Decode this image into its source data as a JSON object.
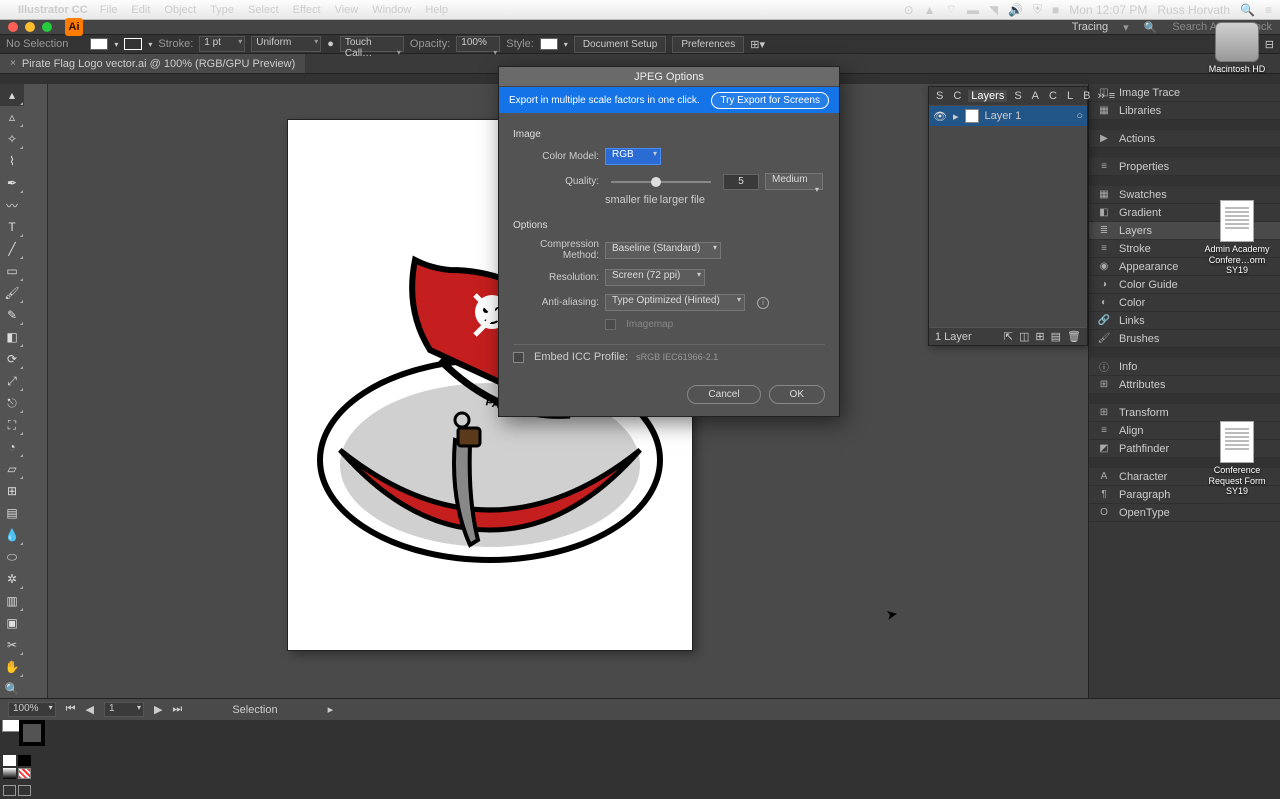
{
  "mac_menu": {
    "app": "Illustrator CC",
    "items": [
      "File",
      "Edit",
      "Object",
      "Type",
      "Select",
      "Effect",
      "View",
      "Window",
      "Help"
    ],
    "time": "Mon 12:07 PM",
    "user": "Russ Horvath"
  },
  "window": {
    "workspace_label": "Tracing",
    "search_placeholder": "Search Adobe Stock"
  },
  "control_bar": {
    "selection": "No Selection",
    "stroke_label": "Stroke:",
    "stroke_value": "1 pt",
    "stroke_profile": "Uniform",
    "brush": "Touch Call…",
    "opacity_label": "Opacity:",
    "opacity_value": "100%",
    "style_label": "Style:",
    "doc_setup": "Document Setup",
    "prefs": "Preferences"
  },
  "tab": {
    "title": "Pirate Flag Logo vector.ai @ 100% (RGB/GPU Preview)"
  },
  "dialog": {
    "title": "JPEG Options",
    "banner_text": "Export in multiple scale factors in one click.",
    "banner_button": "Try Export for Screens",
    "section_image": "Image",
    "color_model_label": "Color Model:",
    "color_model_value": "RGB",
    "quality_label": "Quality:",
    "quality_value": "5",
    "quality_preset": "Medium",
    "smaller_file": "smaller file",
    "larger_file": "larger file",
    "section_options": "Options",
    "compression_label": "Compression Method:",
    "compression_value": "Baseline (Standard)",
    "resolution_label": "Resolution:",
    "resolution_value": "Screen (72 ppi)",
    "antialias_label": "Anti-aliasing:",
    "antialias_value": "Type Optimized (Hinted)",
    "imagemap_label": "Imagemap",
    "embed_label": "Embed ICC Profile:",
    "embed_profile": "sRGB IEC61966-2.1",
    "cancel": "Cancel",
    "ok": "OK"
  },
  "layers_panel": {
    "tabs_left": [
      "S",
      "C"
    ],
    "tab_layers": "Layers",
    "tabs_right": [
      "S",
      "A",
      "C",
      "L",
      "B"
    ],
    "layer_name": "Layer 1",
    "footer_text": "1 Layer"
  },
  "right_panels": {
    "items": [
      [
        "image-trace-icon",
        "Image Trace"
      ],
      [
        "libraries-icon",
        "Libraries"
      ],
      [
        null,
        null
      ],
      [
        "actions-icon",
        "Actions"
      ],
      [
        null,
        null
      ],
      [
        "properties-icon",
        "Properties"
      ],
      [
        null,
        null
      ],
      [
        "swatches-icon",
        "Swatches"
      ],
      [
        "gradient-icon",
        "Gradient"
      ],
      [
        "layers-icon",
        "Layers"
      ],
      [
        "stroke-icon",
        "Stroke"
      ],
      [
        "appearance-icon",
        "Appearance"
      ],
      [
        "color-guide-icon",
        "Color Guide"
      ],
      [
        "color-icon",
        "Color"
      ],
      [
        "links-icon",
        "Links"
      ],
      [
        "brushes-icon",
        "Brushes"
      ],
      [
        null,
        null
      ],
      [
        "info-icon",
        "Info"
      ],
      [
        "attributes-icon",
        "Attributes"
      ],
      [
        null,
        null
      ],
      [
        "transform-icon",
        "Transform"
      ],
      [
        "align-icon",
        "Align"
      ],
      [
        "pathfinder-icon",
        "Pathfinder"
      ],
      [
        null,
        null
      ],
      [
        "character-icon",
        "Character"
      ],
      [
        "paragraph-icon",
        "Paragraph"
      ],
      [
        "opentype-icon",
        "OpenType"
      ]
    ],
    "active": "Layers"
  },
  "desktop": {
    "drive": "Macintosh HD",
    "doc1": "Admin Academy Confere…orm SY19",
    "doc2": "Conference Request Form SY19"
  },
  "status": {
    "zoom": "100%",
    "artboard_nav": "1",
    "tool": "Selection"
  }
}
